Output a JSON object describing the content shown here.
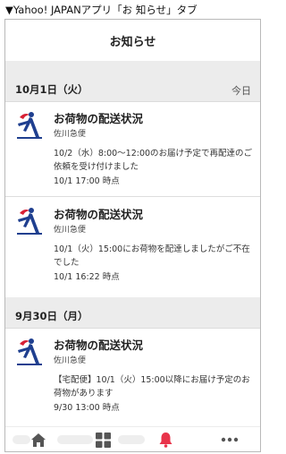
{
  "caption": "▼Yahoo! JAPANアプリ「お 知らせ」タブ",
  "header": {
    "title": "お知らせ"
  },
  "sections": [
    {
      "date": "10月1日（火）",
      "right": "今日"
    },
    {
      "date": "9月30日（月）",
      "right": ""
    }
  ],
  "items": [
    {
      "title": "お荷物の配送状況",
      "sender": "佐川急便",
      "body": "10/2（水）8:00～12:00のお届け予定で再配達のご依頼を受け付けました",
      "time": "10/1 17:00 時点"
    },
    {
      "title": "お荷物の配送状況",
      "sender": "佐川急便",
      "body": "10/1（火）15:00にお荷物を配達しましたがご不在でした",
      "time": "10/1 16:22 時点"
    },
    {
      "title": "お荷物の配送状況",
      "sender": "佐川急便",
      "body": "【宅配便】10/1（火）15:00以降にお届け予定のお荷物があります",
      "time": "9/30 13:00 時点"
    }
  ],
  "tabs": [
    {
      "icon": "home-icon",
      "active": false
    },
    {
      "icon": "grid-icon",
      "active": false
    },
    {
      "icon": "bell-icon",
      "active": true
    },
    {
      "icon": "more-icon",
      "active": false
    }
  ],
  "colors": {
    "accent": "#e8334a",
    "tab_inactive": "#555555",
    "section_bg": "#ececec"
  }
}
